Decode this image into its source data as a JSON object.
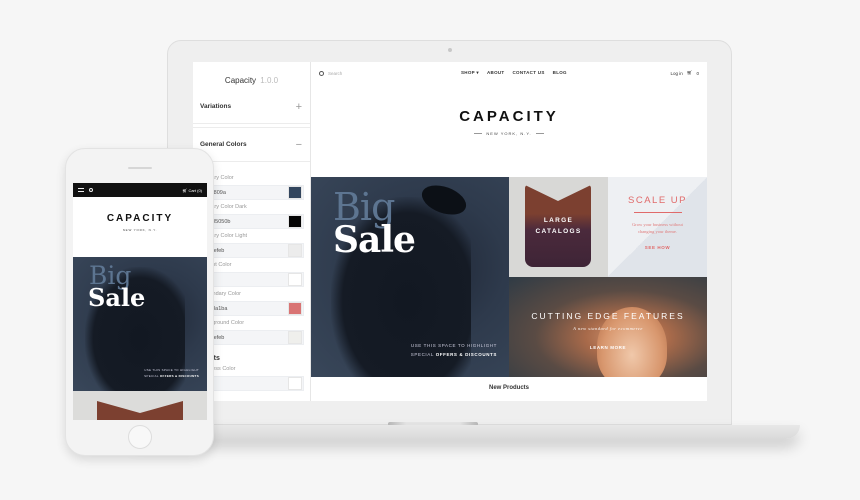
{
  "settings": {
    "app_name": "Capacity",
    "version": "1.0.0",
    "sections": [
      {
        "label": "Variations",
        "toggle": "+"
      },
      {
        "label": "General Colors",
        "toggle": "−"
      }
    ],
    "fields": [
      {
        "label": "Primary Color",
        "value": "#3f809a",
        "swatch": "#33465e"
      },
      {
        "label": "Primary Color Dark",
        "value": "#505050b",
        "swatch": "#050505"
      },
      {
        "label": "Primary Color Light",
        "value": "#efefeb",
        "swatch": "#ececec"
      },
      {
        "label": "Accent Color",
        "value": "#fff",
        "swatch": "#ffffff"
      },
      {
        "label": "Secondary Color",
        "value": "#d8a1ba",
        "swatch": "#d97474"
      },
      {
        "label": "Background Color",
        "value": "#efefeb",
        "swatch": "#efefec"
      }
    ],
    "alerts_heading": "Alerts",
    "alerts_fields": [
      {
        "label": "Success Color",
        "value": "",
        "swatch": "#ffffff"
      }
    ]
  },
  "store": {
    "search_placeholder": "Search",
    "nav": [
      "SHOP ▾",
      "ABOUT",
      "CONTACT US",
      "BLOG"
    ],
    "login": "Log in",
    "cart_count": "0",
    "logo": "CAPACITY",
    "tagline": "NEW YORK, N.Y.",
    "hero": {
      "line1": "Big",
      "line2": "Sale",
      "caption_line1": "USE THIS SPACE TO HIGHLIGHT",
      "caption_prefix": "SPECIAL ",
      "caption_bold": "OFFERS & DISCOUNTS"
    },
    "catalog_tile": {
      "line1": "LARGE",
      "line2": "CATALOGS"
    },
    "scale_tile": {
      "title": "SCALE UP",
      "desc": "Grow your business without changing your theme.",
      "link": "SEE HOW"
    },
    "features_tile": {
      "title": "CUTTING EDGE FEATURES",
      "subtitle": "A new standard for ecommerce",
      "link": "LEARN MORE"
    },
    "new_products": "New Products"
  },
  "phone": {
    "cart_label": "Cart (0)",
    "logo": "CAPACITY",
    "tagline": "NEW YORK, N.Y.",
    "hero_line1": "Big",
    "hero_line2": "Sale",
    "caption_line1": "USE THIS SPACE TO HIGHLIGHT",
    "caption_prefix": "SPECIAL ",
    "caption_bold": "OFFERS & DISCOUNTS"
  }
}
